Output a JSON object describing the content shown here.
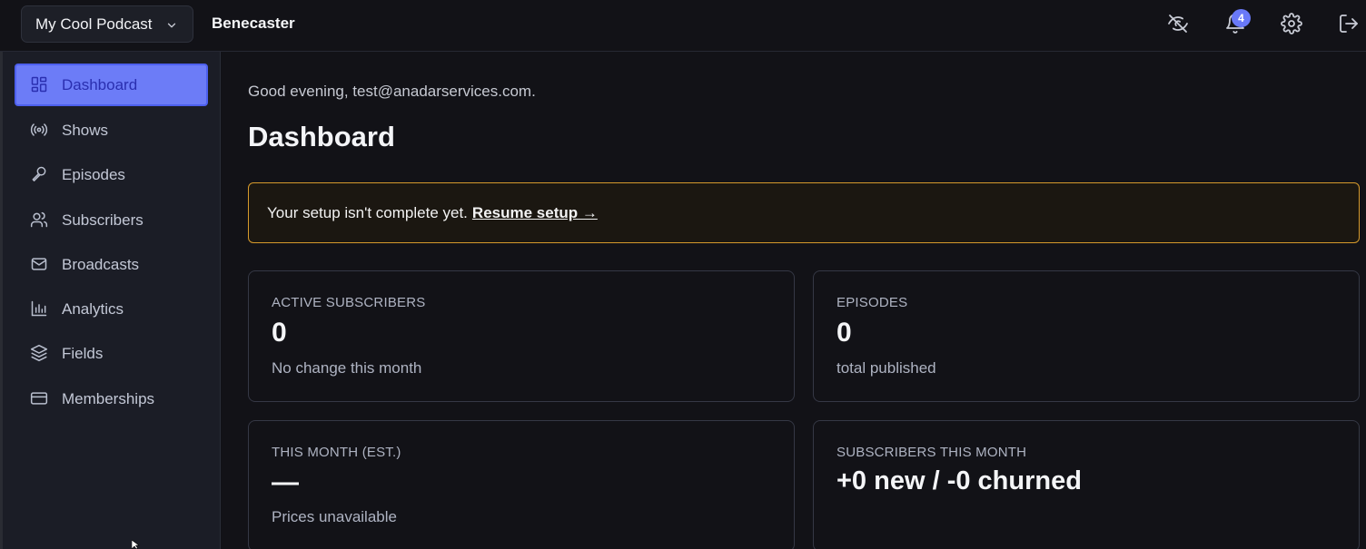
{
  "topbar": {
    "show_name": "My Cool Podcast",
    "brand": "Benecaster",
    "notification_count": "4",
    "icons": [
      "eye-off-icon",
      "bell-icon",
      "gear-icon",
      "logout-icon"
    ]
  },
  "sidebar": {
    "items": [
      {
        "label": "Dashboard",
        "icon": "dashboard-icon",
        "active": true
      },
      {
        "label": "Shows",
        "icon": "broadcast-icon"
      },
      {
        "label": "Episodes",
        "icon": "microphone-icon"
      },
      {
        "label": "Subscribers",
        "icon": "users-icon"
      },
      {
        "label": "Broadcasts",
        "icon": "mail-icon"
      },
      {
        "label": "Analytics",
        "icon": "bar-chart-icon"
      },
      {
        "label": "Fields",
        "icon": "layers-icon"
      },
      {
        "label": "Memberships",
        "icon": "credit-card-icon"
      }
    ]
  },
  "main": {
    "greeting": "Good evening, test@anadarservices.com.",
    "title": "Dashboard",
    "alert": {
      "text": "Your setup isn't complete yet.",
      "link": "Resume setup →"
    },
    "cards": [
      {
        "label": "ACTIVE SUBSCRIBERS",
        "value": "0",
        "sub": "No change this month"
      },
      {
        "label": "EPISODES",
        "value": "0",
        "sub": "total published"
      },
      {
        "label": "THIS MONTH (EST.)",
        "value": "—",
        "sub": "Prices unavailable"
      },
      {
        "label": "SUBSCRIBERS THIS MONTH",
        "value": "+0 new / -0 churned",
        "sub": ""
      }
    ]
  },
  "colors": {
    "accent": "#6c7cf7",
    "warning_border": "#d69a2c",
    "background": "#121217",
    "sidebar": "#1b1d26"
  }
}
